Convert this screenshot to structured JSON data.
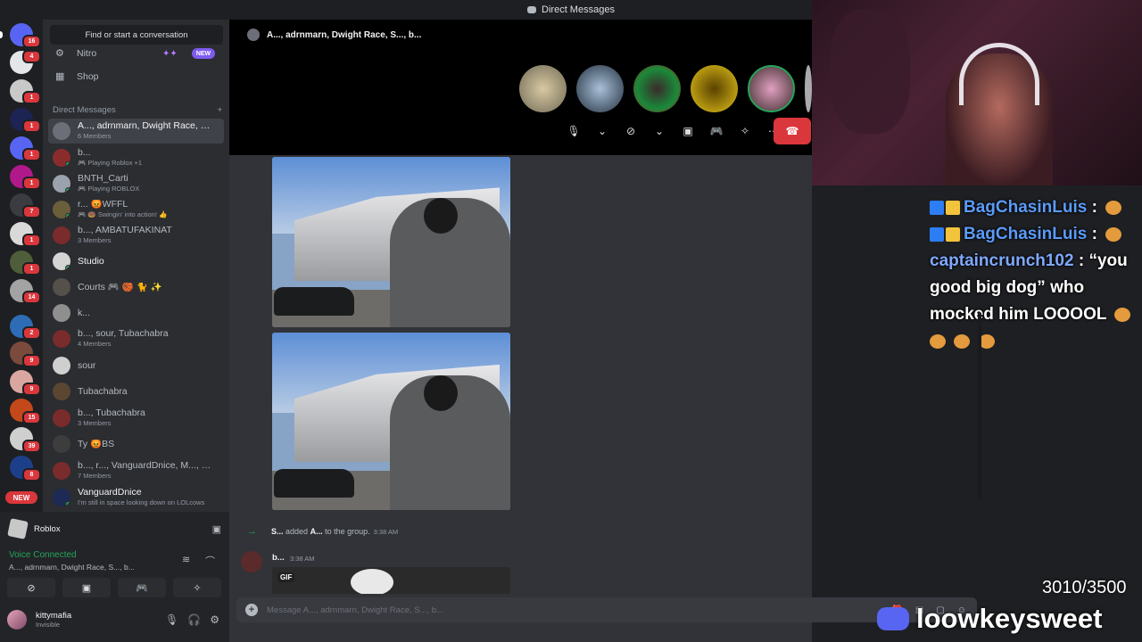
{
  "window": {
    "title": "Direct Messages"
  },
  "rail": {
    "servers": [
      {
        "badge": "16"
      },
      {
        "badge": "4"
      },
      {
        "badge": "1"
      },
      {
        "badge": "1"
      },
      {
        "badge": "1"
      },
      {
        "badge": "1"
      },
      {
        "badge": "7"
      },
      {
        "badge": "1"
      },
      {
        "badge": "1"
      },
      {
        "badge": "14"
      },
      {
        "badge": "2"
      },
      {
        "badge": "9"
      },
      {
        "badge": "9"
      },
      {
        "badge": "15"
      },
      {
        "badge": "39"
      },
      {
        "badge": "8"
      }
    ],
    "new_label": "NEW"
  },
  "sidebar": {
    "search_placeholder": "Find or start a conversation",
    "nitro": "Nitro",
    "nitro_new": "NEW",
    "shop": "Shop",
    "dm_header": "Direct Messages",
    "dm_add": "+",
    "dms": [
      {
        "name": "A..., adrnmarn, Dwight Race, S...",
        "sub": "6 Members"
      },
      {
        "name": "b...",
        "sub": "🎮 Playing Roblox +1"
      },
      {
        "name": "BNTH_Carti",
        "sub": "🎮 Playing ROBLOX"
      },
      {
        "name": "r... 😡WFFL",
        "sub": "🎮 🍩 Swingin' into action! 👍"
      },
      {
        "name": "b..., AMBATUFAKINAT",
        "sub": "3 Members"
      },
      {
        "name": "Studio",
        "sub": ""
      },
      {
        "name": "Courts 🎮 🏀 🐈 ✨",
        "sub": ""
      },
      {
        "name": "k...",
        "sub": ""
      },
      {
        "name": "b..., sour, Tubachabra",
        "sub": "4 Members"
      },
      {
        "name": "sour",
        "sub": ""
      },
      {
        "name": "Tubachabra",
        "sub": ""
      },
      {
        "name": "b..., Tubachabra",
        "sub": "3 Members"
      },
      {
        "name": "Ty 😡BS",
        "sub": ""
      },
      {
        "name": "b..., r..., VanguardDnice, M..., D...",
        "sub": "7 Members"
      },
      {
        "name": "VanguardDnice",
        "sub": "I'm still in space looking down on LOLcows"
      }
    ]
  },
  "panel": {
    "game": "Roblox",
    "voice_status": "Voice Connected",
    "voice_channel": "A..., adrnmarn, Dwight Race, S..., b...",
    "username": "kittymafia",
    "user_status": "Invisible"
  },
  "call": {
    "header": "A..., adrnmarn, Dwight Race, S..., b..."
  },
  "chat": {
    "sys_actor": "S...",
    "sys_added": "added",
    "sys_target": "A...",
    "sys_rest": "to the group.",
    "sys_time": "3:38 AM",
    "msg_author": "b...",
    "msg_time": "3:38 AM",
    "gif_label": "GIF",
    "composer_placeholder": "Message A..., adrnmarn, Dwight Race, S..., b..."
  },
  "overlay": {
    "chat": [
      {
        "user": "BagChasinLuis",
        "sep": ":",
        "text": ""
      },
      {
        "user": "BagChasinLuis",
        "sep": ":",
        "text": ""
      },
      {
        "user": "captaincrunch102",
        "sep": ":",
        "text": "“you good big dog” who mocked him LOOOOL"
      }
    ],
    "counter": "3010/3500",
    "brand": "loowkeysweet"
  }
}
